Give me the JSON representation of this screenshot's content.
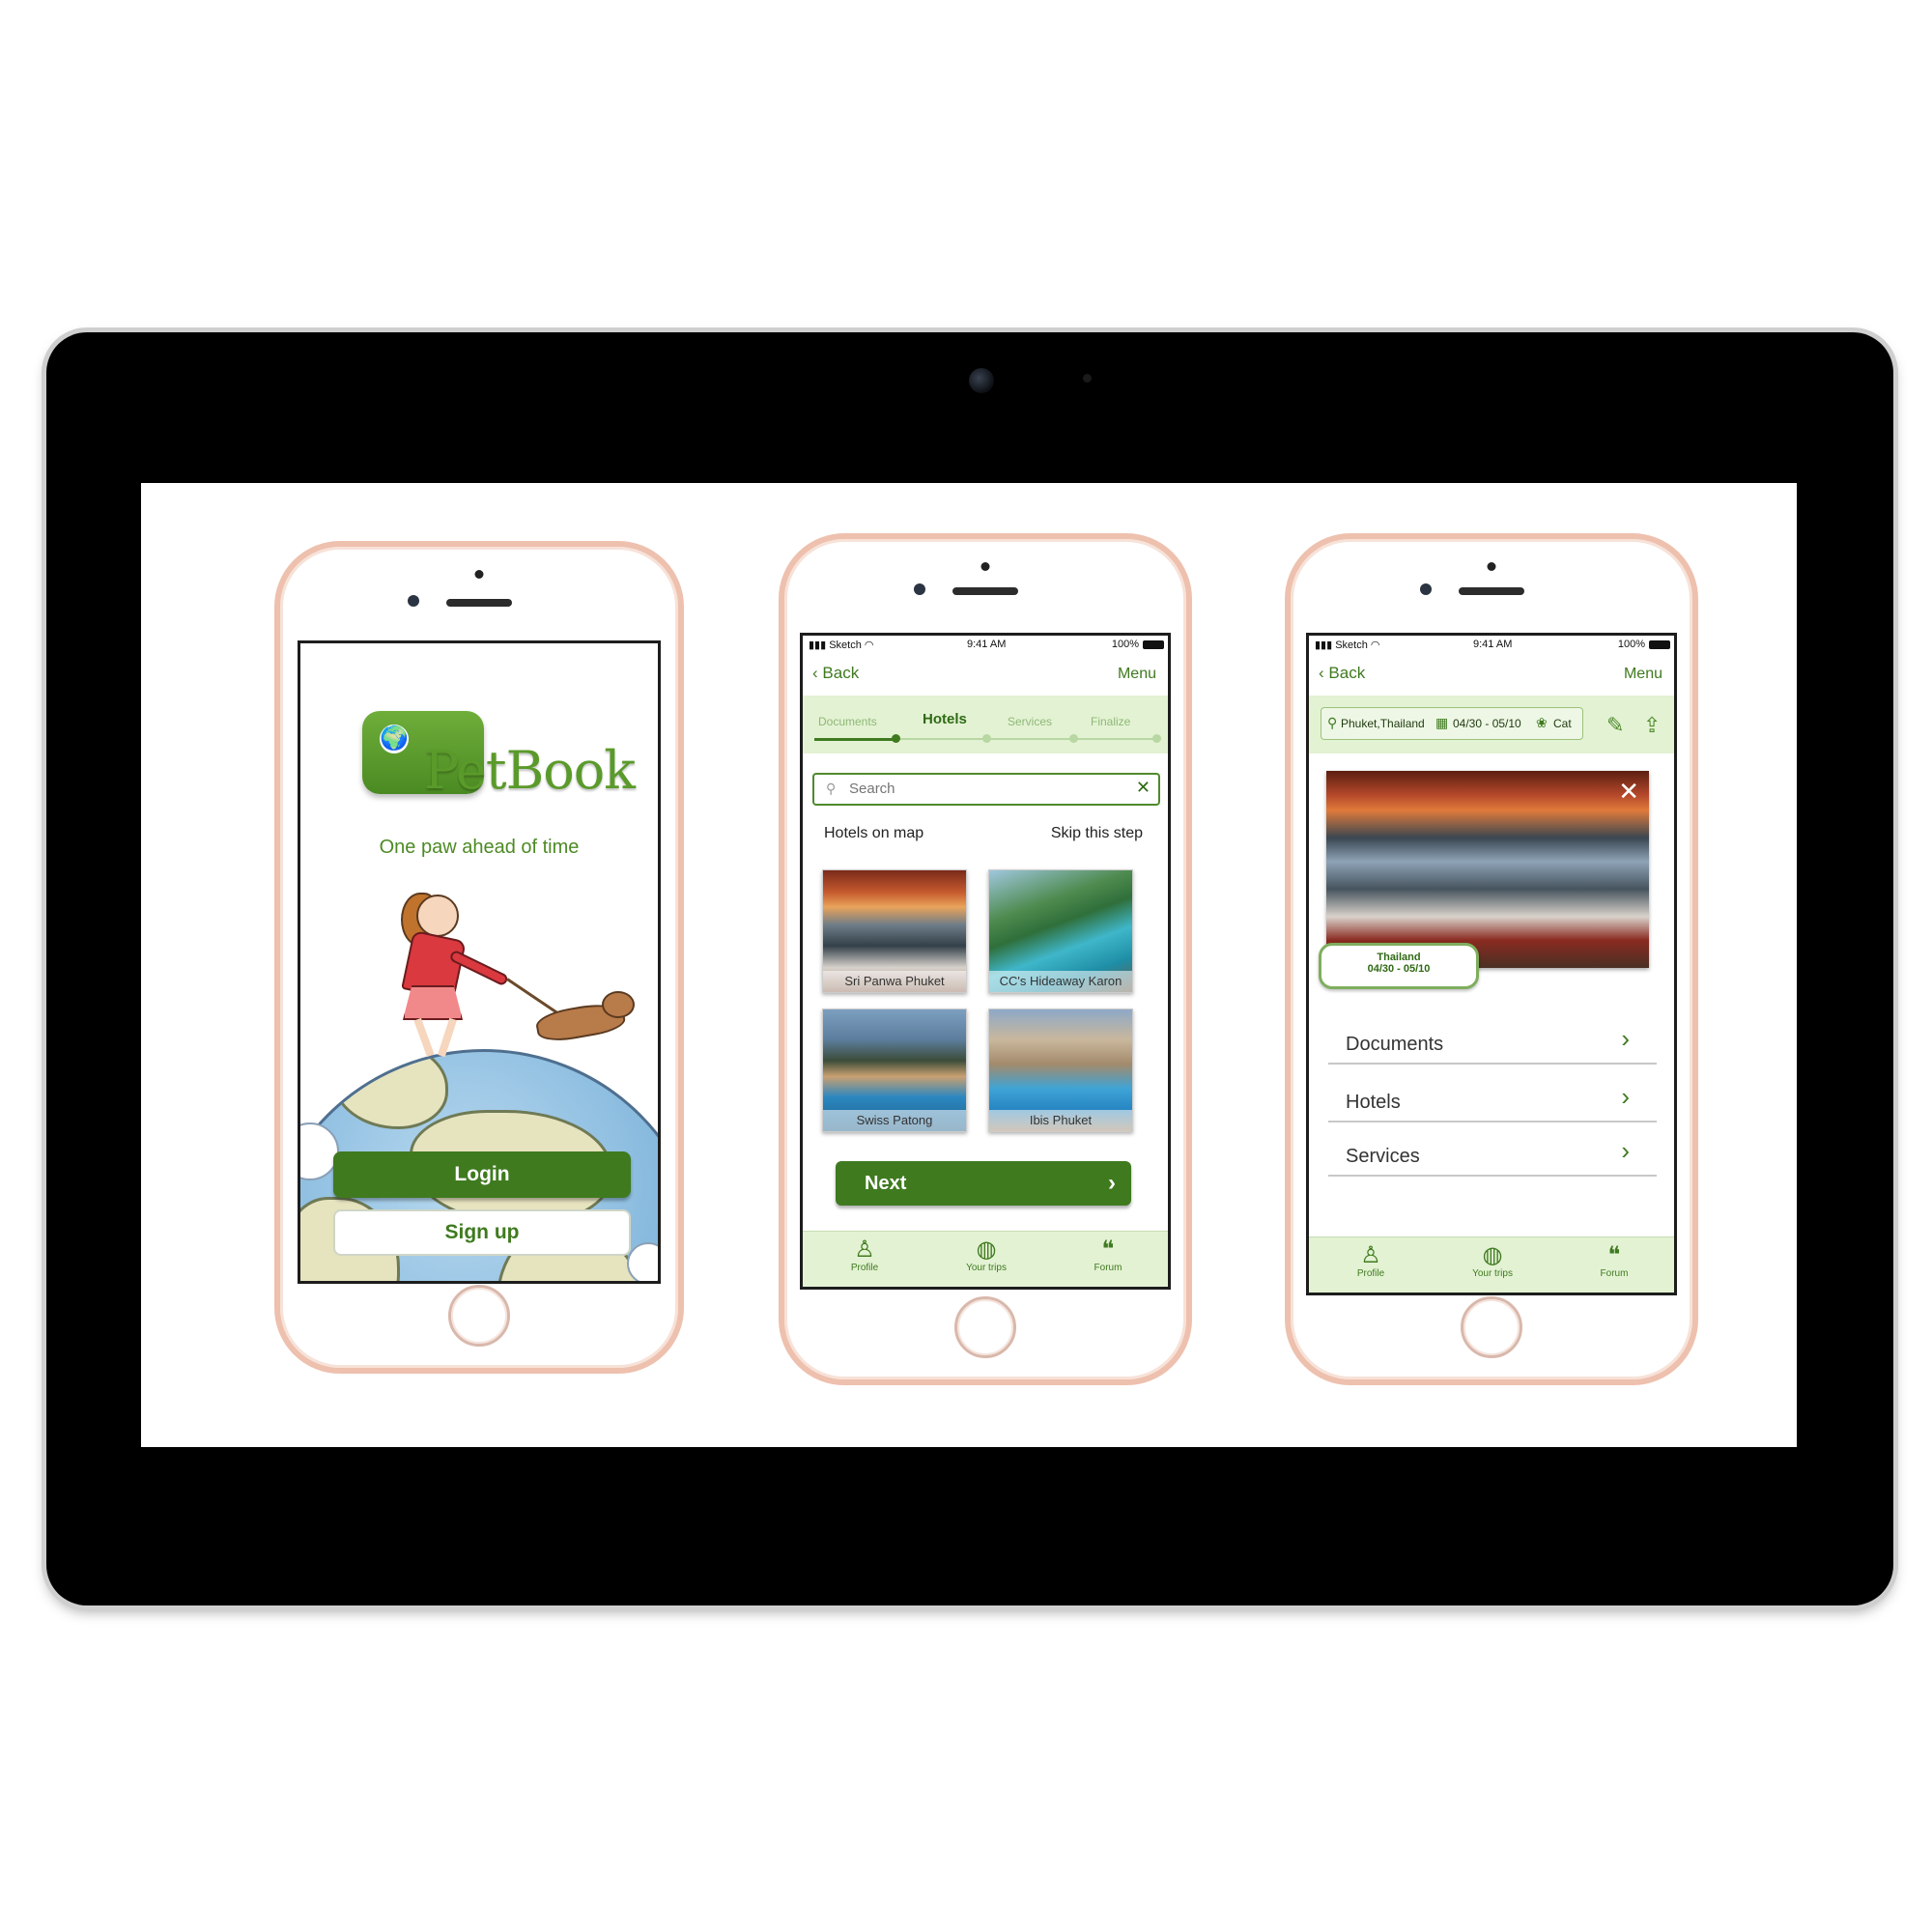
{
  "colors": {
    "brand_green": "#3f7a1f",
    "light_green": "#e3f2d3",
    "phone_frame": "#eec0ae",
    "tablet": "#000000"
  },
  "login": {
    "logo": "PetBook",
    "tagline": "One paw ahead of time",
    "login_label": "Login",
    "signup_label": "Sign up"
  },
  "hotels": {
    "status": {
      "carrier": "Sketch",
      "time": "9:41 AM",
      "battery": "100%"
    },
    "nav": {
      "back": "Back",
      "menu": "Menu"
    },
    "steps": [
      {
        "label": "Documents",
        "active": false
      },
      {
        "label": "Hotels",
        "active": true
      },
      {
        "label": "Services",
        "active": false
      },
      {
        "label": "Finalize",
        "active": false
      }
    ],
    "search_placeholder": "Search",
    "hotels_on_map": "Hotels on map",
    "skip": "Skip this step",
    "list": [
      {
        "name": "Sri Panwa Phuket",
        "photo": "villa-sunset"
      },
      {
        "name": "CC's Hideaway Karon",
        "photo": "pool-palms"
      },
      {
        "name": "Swiss Patong",
        "photo": "pool-evening"
      },
      {
        "name": "Ibis Phuket",
        "photo": "pool-courtyard"
      }
    ],
    "next_label": "Next",
    "tabs": [
      {
        "label": "Profile",
        "icon": "person-icon"
      },
      {
        "label": "Your trips",
        "icon": "globe-icon"
      },
      {
        "label": "Forum",
        "icon": "chat-icon"
      }
    ]
  },
  "trip": {
    "status": {
      "carrier": "Sketch",
      "time": "9:41 AM",
      "battery": "100%"
    },
    "nav": {
      "back": "Back",
      "menu": "Menu"
    },
    "location": "Phuket,Thailand",
    "dates": "04/30 - 05/10",
    "pet": "Cat",
    "badge_title": "Thailand",
    "badge_dates": "04/30 - 05/10",
    "sections": [
      "Documents",
      "Hotels",
      "Services"
    ],
    "tabs": [
      {
        "label": "Profile",
        "icon": "person-icon"
      },
      {
        "label": "Your trips",
        "icon": "globe-icon"
      },
      {
        "label": "Forum",
        "icon": "chat-icon"
      }
    ]
  }
}
